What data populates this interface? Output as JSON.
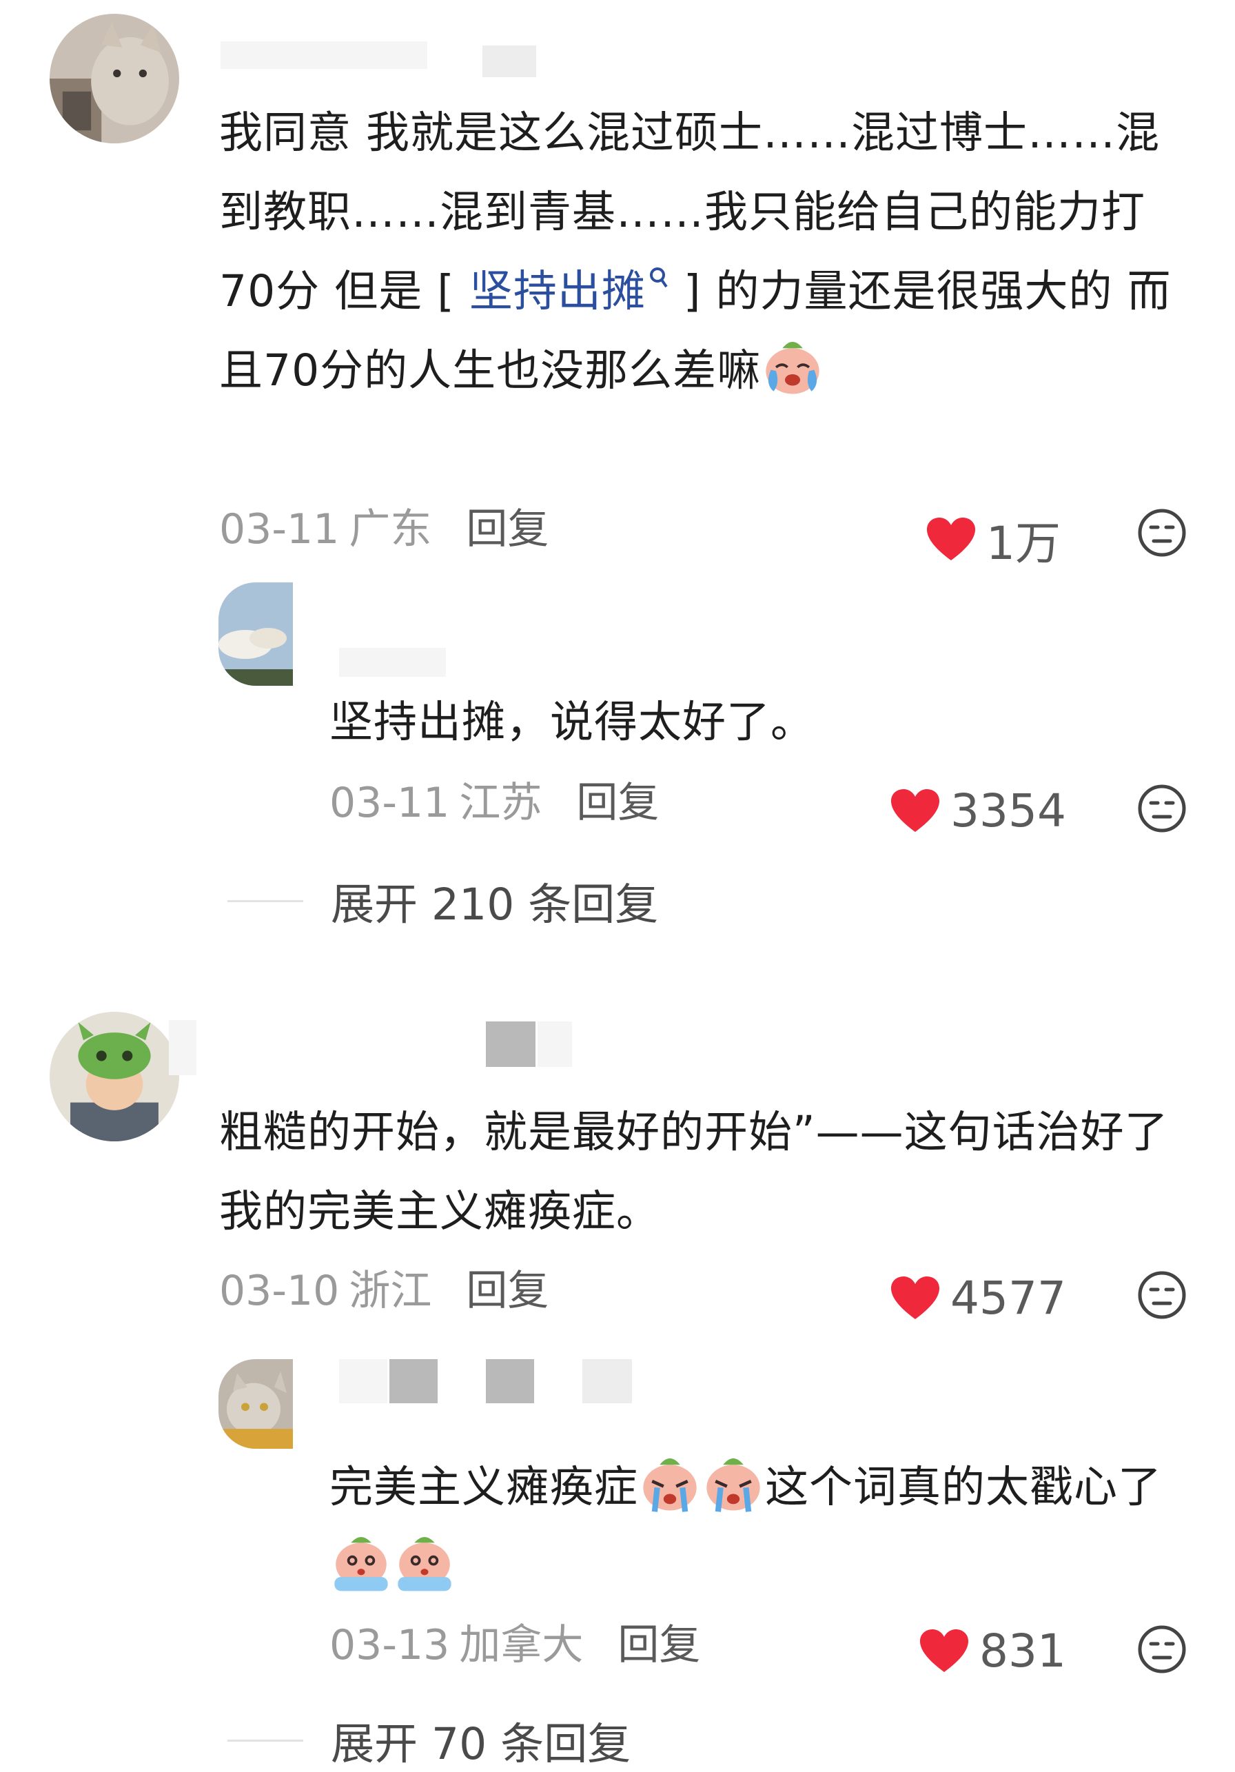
{
  "comments": [
    {
      "text_parts": [
        "我同意 我就是这么混过硕士……混过博士……混到教职……混到青基……我只能给自己的能力打70分 但是 ",
        "[",
        "坚持出摊",
        "]",
        " 的力量还是很强大的 而且70分的人生也没那么差嘛"
      ],
      "date": "03-11",
      "region": "广东",
      "reply_label": "回复",
      "likes": "1万",
      "replies": [
        {
          "text": "坚持出摊，说得太好了。",
          "date": "03-11",
          "region": "江苏",
          "reply_label": "回复",
          "likes": "3354"
        }
      ],
      "expand_label": "展开 210 条回复"
    },
    {
      "text": "粗糙的开始，就是最好的开始”——这句话治好了我的完美主义瘫痪症。",
      "date": "03-10",
      "region": "浙江",
      "reply_label": "回复",
      "likes": "4577",
      "replies": [
        {
          "text_parts": [
            "完美主义瘫痪症",
            "这个词真的太戳心了"
          ],
          "date": "03-13",
          "region": "加拿大",
          "reply_label": "回复",
          "likes": "831"
        }
      ],
      "expand_label": "展开 70 条回复"
    }
  ],
  "colors": {
    "heart": "#f0283c",
    "link": "#2b4f9e",
    "meta_gray": "#9a9a9a"
  },
  "icons": {
    "like": "heart-icon",
    "dislike": "dislike-face-icon",
    "search": "search-icon",
    "emoji_cry": "crying-face-emoji",
    "emoji_sob": "sobbing-face-emoji"
  }
}
